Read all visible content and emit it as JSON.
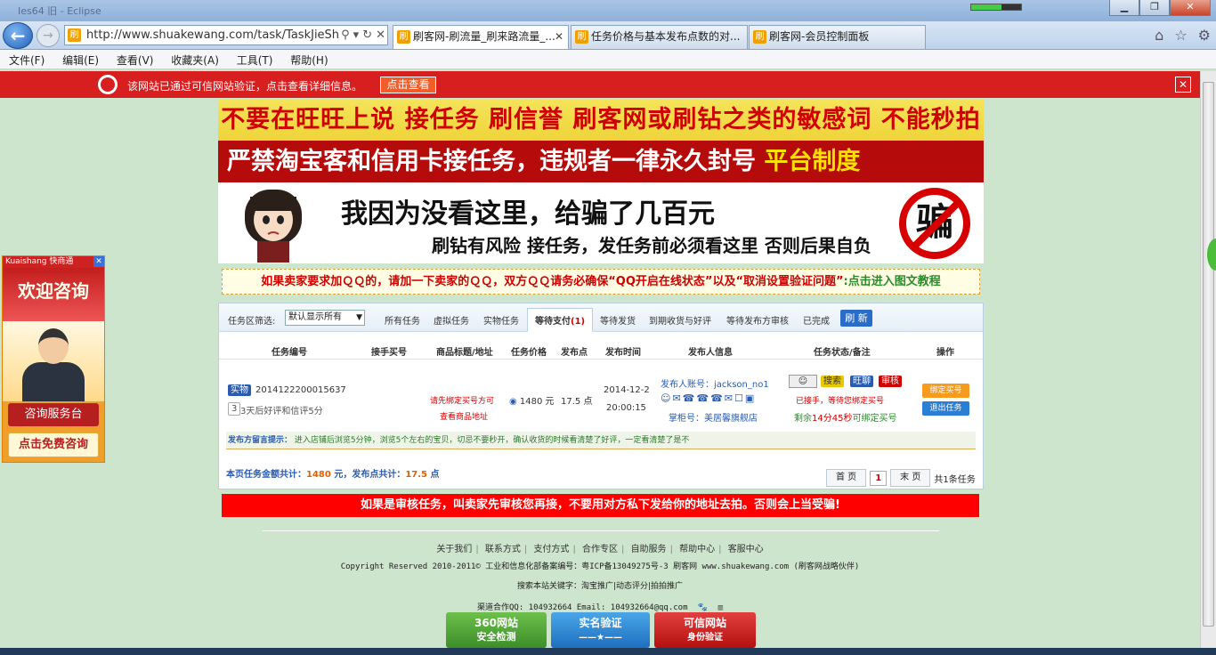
{
  "window": {
    "title": "Ies64 旧 - Eclipse"
  },
  "browser": {
    "url": "http://www.shuakewang.com/task/TaskJieShou",
    "tabs": [
      {
        "label": "刷客网-刷流量_刷来路流量_...",
        "active": true
      },
      {
        "label": "任务价格与基本发布点数的对..."
      },
      {
        "label": "刷客网-会员控制面板"
      }
    ],
    "menu": [
      "文件(F)",
      "编辑(E)",
      "查看(V)",
      "收藏夹(A)",
      "工具(T)",
      "帮助(H)"
    ]
  },
  "verify_bar": {
    "text": "该网站已通过可信网站验证，点击查看详细信息。",
    "button": "点击查看"
  },
  "banners": {
    "line1": "不要在旺旺上说 接任务 刷信誉 刷客网或刷钻之类的敏感词 不能秒拍",
    "line2_white": "严禁淘宝客和信用卡接任务，违规者一律永久封号",
    "line2_yellow": "平台制度",
    "line3_main": "我因为没看这里，给骗了几百元",
    "line3_sub": "刷钻有风险  接任务，发任务前必须看这里 否则后果自负",
    "stamp": "骗"
  },
  "notice": {
    "red": "如果卖家要求加ＱＱ的，请加一下卖家的ＱＱ，双方ＱＱ请务必确保“QQ开启在线状态”以及“取消设置验证问题”",
    "green": ":点击进入图文教程"
  },
  "side_ad": {
    "brand": "Kuaishang 快商通",
    "headline": "欢迎咨询",
    "btn1": "咨询服务台",
    "btn2": "点击免费咨询"
  },
  "filter": {
    "label": "任务区筛选:",
    "select_value": "默认显示所有",
    "tabs": [
      {
        "label": "所有任务"
      },
      {
        "label": "虚拟任务"
      },
      {
        "label": "实物任务"
      },
      {
        "label": "等待支付",
        "count": "(1)",
        "active": true
      },
      {
        "label": "等待发货"
      },
      {
        "label": "到期收货与好评"
      },
      {
        "label": "等待发布方审核"
      },
      {
        "label": "已完成"
      }
    ],
    "refresh": "刷 新"
  },
  "table": {
    "headers": [
      "任务编号",
      "接手买号",
      "商品标题/地址",
      "任务价格",
      "发布点",
      "发布时间",
      "发布人信息",
      "任务状态/备注",
      "操作"
    ],
    "row": {
      "type_badge": "实物",
      "task_id": "2014122200015637",
      "note_badge": "3",
      "note": "3天后好评和信评5分",
      "title_line1": "请先绑定买号方可",
      "title_line2": "查看商品地址",
      "price": "1480 元",
      "points": "17.5 点",
      "date": "2014-12-2",
      "time": "20:00:15",
      "publisher": "发布人账号：jackson_no1",
      "shop": "掌柜号：美居馨旗舰店",
      "status_tags": [
        "搜索",
        "旺聊",
        "审核"
      ],
      "status1": "已接手，等待您绑定买号",
      "status2_prefix": "剩余",
      "status2_time": "14分45秒",
      "status2_suffix": "可绑定买号",
      "op1": "绑定买号",
      "op2": "退出任务"
    },
    "hint_label": "发布方留言提示：",
    "hint": "进入店铺后浏览5分钟，浏览5个左右的宝贝，切忌不要秒开，确认收货的时候看清楚了好评，一定看清楚了是不",
    "totals_prefix": "本页任务金额共计：",
    "totals_amount": "1480",
    "totals_mid": "元，发布点共计：",
    "totals_points": "17.5",
    "totals_suffix": "点",
    "pager": {
      "first": "首 页",
      "current": "1",
      "last": "末 页",
      "count": "共1条任务"
    }
  },
  "red_warning": "如果是审核任务，叫卖家先审核您再接，不要用对方私下发给你的地址去拍。否则会上当受骗!",
  "footer": {
    "links": [
      "关于我们",
      "联系方式",
      "支付方式",
      "合作专区",
      "自助服务",
      "帮助中心",
      "客服中心"
    ],
    "copyright": "Copyright Reserved 2010-2011© 工业和信息化部备案编号：粤ICP备13049275号-3 刷客网 www.shuakewang.com (刷客网战略伙伴)",
    "keywords": "搜索本站关键字：淘宝推广|动态评分|拍拍推广",
    "contact": "渠道合作QQ: 104932664  Email: 104932664@qq.com",
    "badges": [
      {
        "line1": "360网站",
        "line2": "安全检测"
      },
      {
        "line1": "实名验证",
        "line2": "——★——"
      },
      {
        "line1": "可信网站",
        "line2": "身份验证"
      }
    ]
  }
}
